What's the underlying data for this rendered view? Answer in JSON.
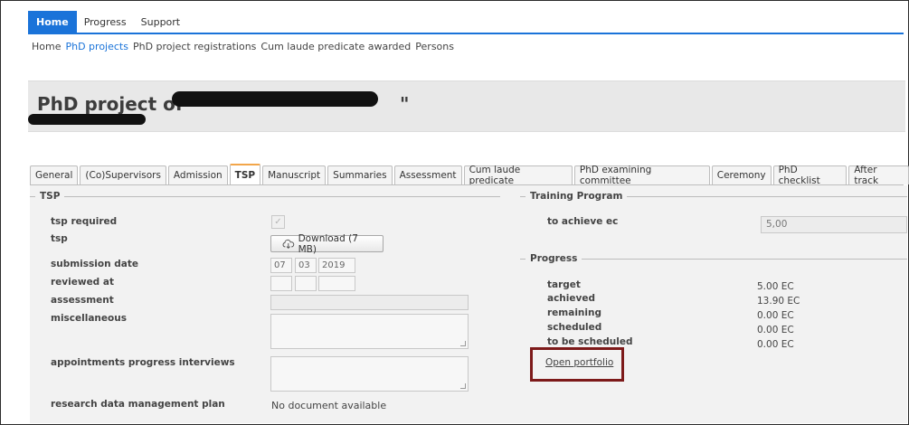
{
  "topnav": {
    "items": [
      "Home",
      "Progress",
      "Support"
    ],
    "active": "Home"
  },
  "subnav": {
    "items": [
      "Home",
      "PhD projects",
      "PhD project registrations",
      "Cum laude predicate awarded",
      "Persons"
    ],
    "current": "PhD projects"
  },
  "page": {
    "title_prefix": "PhD project of \"",
    "title_suffix": "\""
  },
  "tabs": [
    "General",
    "(Co)Supervisors",
    "Admission",
    "TSP",
    "Manuscript",
    "Summaries",
    "Assessment",
    "Cum laude predicate",
    "PhD examining committee",
    "Ceremony",
    "PhD checklist",
    "After track"
  ],
  "active_tab": "TSP",
  "tsp": {
    "legend": "TSP",
    "tsp_required_label": "tsp required",
    "tsp_required_checked": true,
    "tsp_label": "tsp",
    "download_label": "Download (7 MB)",
    "submission_date_label": "submission date",
    "submission_date": {
      "day": "07",
      "month": "03",
      "year": "2019"
    },
    "reviewed_at_label": "reviewed at",
    "assessment_label": "assessment",
    "miscellaneous_label": "miscellaneous",
    "appointments_label": "appointments progress interviews",
    "rdm_plan_label": "research data management plan",
    "rdm_plan_value": "No document available"
  },
  "training_program": {
    "legend": "Training Program",
    "to_achieve_label": "to achieve ec",
    "to_achieve_value": "5,00"
  },
  "progress": {
    "legend": "Progress",
    "rows": [
      {
        "label": "target",
        "value": "5.00 EC"
      },
      {
        "label": "achieved",
        "value": "13.90 EC"
      },
      {
        "label": "remaining",
        "value": "0.00 EC"
      },
      {
        "label": "scheduled",
        "value": "0.00 EC"
      },
      {
        "label": "to be scheduled",
        "value": "0.00 EC"
      }
    ],
    "open_portfolio": "Open portfolio"
  },
  "colors": {
    "accent": "#1a73d9",
    "active_tab": "#f2a64a",
    "highlight": "#7d1a1a"
  },
  "icons": {
    "download": "cloud-download-icon"
  }
}
